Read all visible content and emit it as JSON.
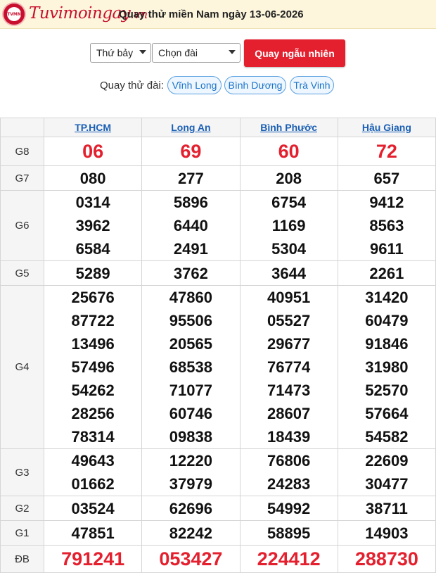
{
  "header": {
    "logo_name": "Tuvimoingay",
    "logo_tld": ".vn",
    "logo_badge": "TVMN",
    "title": "Quay thử miền Nam ngày 13-06-2026"
  },
  "controls": {
    "day_select": "Thứ bảy",
    "station_select": "Chọn đài",
    "random_button": "Quay ngẫu nhiên"
  },
  "quick": {
    "label": "Quay thử đài:",
    "stations": [
      "Vĩnh Long",
      "Bình Dương",
      "Trà Vinh"
    ]
  },
  "table": {
    "provinces": [
      "TP.HCM",
      "Long An",
      "Bình Phước",
      "Hậu Giang"
    ],
    "rows": [
      {
        "label": "G8",
        "values": [
          [
            "06"
          ],
          [
            "69"
          ],
          [
            "60"
          ],
          [
            "72"
          ]
        ],
        "red": true
      },
      {
        "label": "G7",
        "values": [
          [
            "080"
          ],
          [
            "277"
          ],
          [
            "208"
          ],
          [
            "657"
          ]
        ]
      },
      {
        "label": "G6",
        "values": [
          [
            "0314",
            "3962",
            "6584"
          ],
          [
            "5896",
            "6440",
            "2491"
          ],
          [
            "6754",
            "1169",
            "5304"
          ],
          [
            "9412",
            "8563",
            "9611"
          ]
        ]
      },
      {
        "label": "G5",
        "values": [
          [
            "5289"
          ],
          [
            "3762"
          ],
          [
            "3644"
          ],
          [
            "2261"
          ]
        ]
      },
      {
        "label": "G4",
        "values": [
          [
            "25676",
            "87722",
            "13496",
            "57496",
            "54262",
            "28256",
            "78314"
          ],
          [
            "47860",
            "95506",
            "20565",
            "68538",
            "71077",
            "60746",
            "09838"
          ],
          [
            "40951",
            "05527",
            "29677",
            "76774",
            "71473",
            "28607",
            "18439"
          ],
          [
            "31420",
            "60479",
            "91846",
            "31980",
            "52570",
            "57664",
            "54582"
          ]
        ]
      },
      {
        "label": "G3",
        "values": [
          [
            "49643",
            "01662"
          ],
          [
            "12220",
            "37979"
          ],
          [
            "76806",
            "24283"
          ],
          [
            "22609",
            "30477"
          ]
        ]
      },
      {
        "label": "G2",
        "values": [
          [
            "03524"
          ],
          [
            "62696"
          ],
          [
            "54992"
          ],
          [
            "38711"
          ]
        ]
      },
      {
        "label": "G1",
        "values": [
          [
            "47851"
          ],
          [
            "82242"
          ],
          [
            "58895"
          ],
          [
            "14903"
          ]
        ]
      },
      {
        "label": "ĐB",
        "values": [
          [
            "791241"
          ],
          [
            "053427"
          ],
          [
            "224412"
          ],
          [
            "288730"
          ]
        ],
        "red": true
      }
    ]
  },
  "colors": {
    "accent_red": "#e4202e",
    "link_blue": "#1a5fb4",
    "header_bg": "#fdf6dc"
  }
}
